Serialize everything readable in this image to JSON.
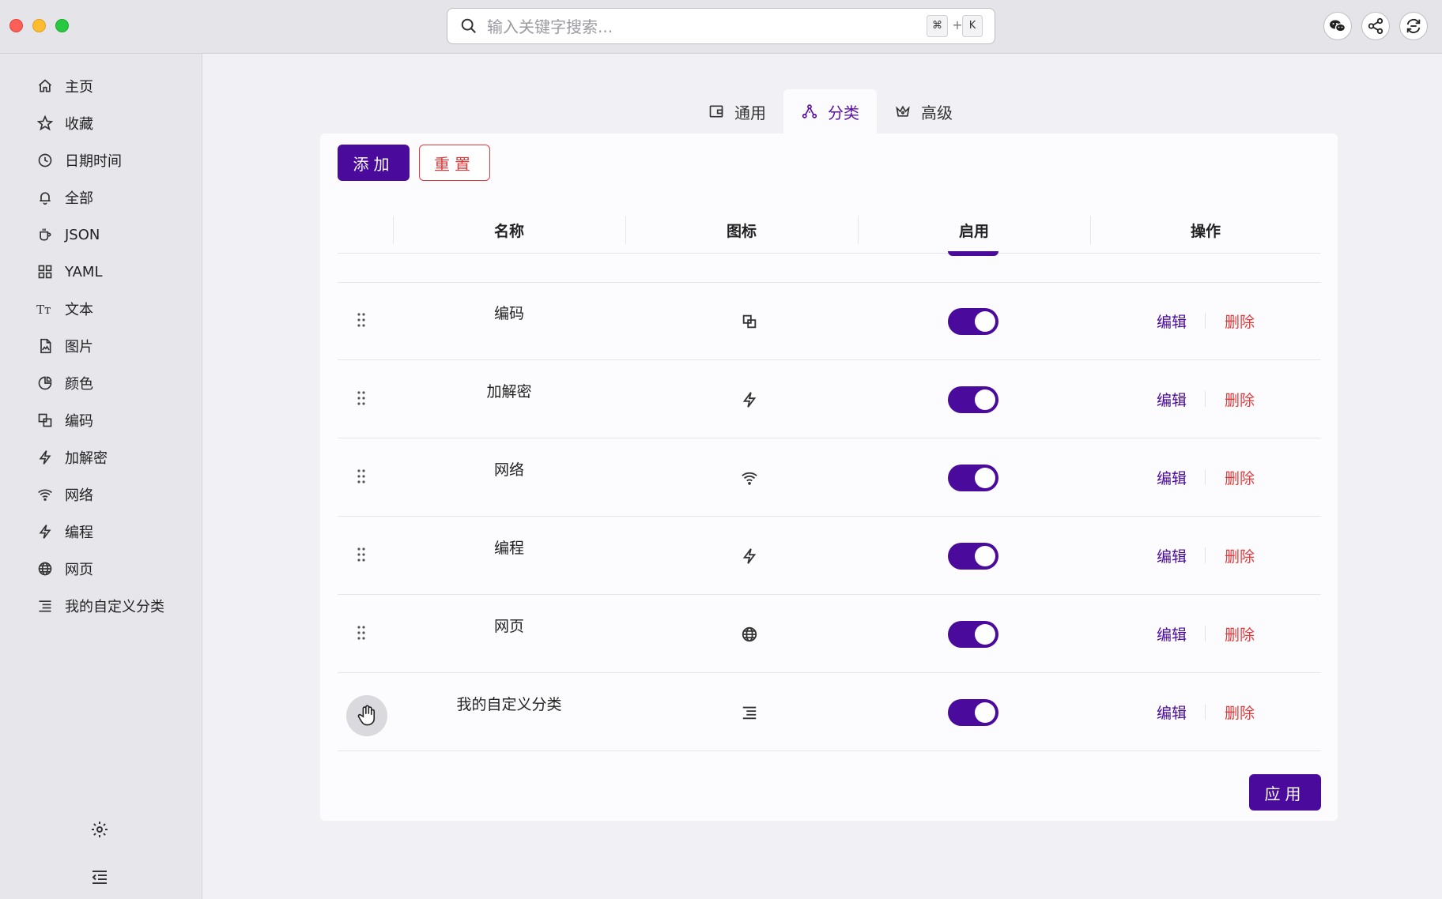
{
  "search": {
    "placeholder": "输入关键字搜索...",
    "shortcut_mod": "⌘",
    "shortcut_plus": "+",
    "shortcut_key": "K"
  },
  "sidebar": {
    "items": [
      {
        "label": "主页",
        "icon": "home-icon"
      },
      {
        "label": "收藏",
        "icon": "star-icon"
      },
      {
        "label": "日期时间",
        "icon": "clock-icon"
      },
      {
        "label": "全部",
        "icon": "bell-icon"
      },
      {
        "label": "JSON",
        "icon": "cup-icon"
      },
      {
        "label": "YAML",
        "icon": "grid-icon"
      },
      {
        "label": "文本",
        "icon": "text-icon"
      },
      {
        "label": "图片",
        "icon": "file-image-icon"
      },
      {
        "label": "颜色",
        "icon": "pie-icon"
      },
      {
        "label": "编码",
        "icon": "copy-icon"
      },
      {
        "label": "加解密",
        "icon": "bolt-icon"
      },
      {
        "label": "网络",
        "icon": "wifi-icon"
      },
      {
        "label": "编程",
        "icon": "bolt-icon"
      },
      {
        "label": "网页",
        "icon": "globe-icon"
      },
      {
        "label": "我的自定义分类",
        "icon": "list-icon"
      }
    ]
  },
  "tabs": [
    {
      "label": "通用",
      "icon": "wallet-icon",
      "active": false
    },
    {
      "label": "分类",
      "icon": "nodes-icon",
      "active": true
    },
    {
      "label": "高级",
      "icon": "crown-icon",
      "active": false
    }
  ],
  "toolbar": {
    "add_label": "添加",
    "reset_label": "重置",
    "apply_label": "应用"
  },
  "table": {
    "headers": [
      "名称",
      "图标",
      "启用",
      "操作"
    ],
    "rows": [
      {
        "name": "编码",
        "icon": "copy-icon",
        "enabled": true,
        "edit": "编辑",
        "delete": "删除"
      },
      {
        "name": "加解密",
        "icon": "bolt-icon",
        "enabled": true,
        "edit": "编辑",
        "delete": "删除"
      },
      {
        "name": "网络",
        "icon": "wifi-icon",
        "enabled": true,
        "edit": "编辑",
        "delete": "删除"
      },
      {
        "name": "编程",
        "icon": "bolt-icon",
        "enabled": true,
        "edit": "编辑",
        "delete": "删除"
      },
      {
        "name": "网页",
        "icon": "globe-icon",
        "enabled": true,
        "edit": "编辑",
        "delete": "删除"
      },
      {
        "name": "我的自定义分类",
        "icon": "list-icon",
        "enabled": true,
        "edit": "编辑",
        "delete": "删除"
      }
    ]
  },
  "colors": {
    "accent": "#4a0a9c",
    "danger": "#e03a3a"
  }
}
